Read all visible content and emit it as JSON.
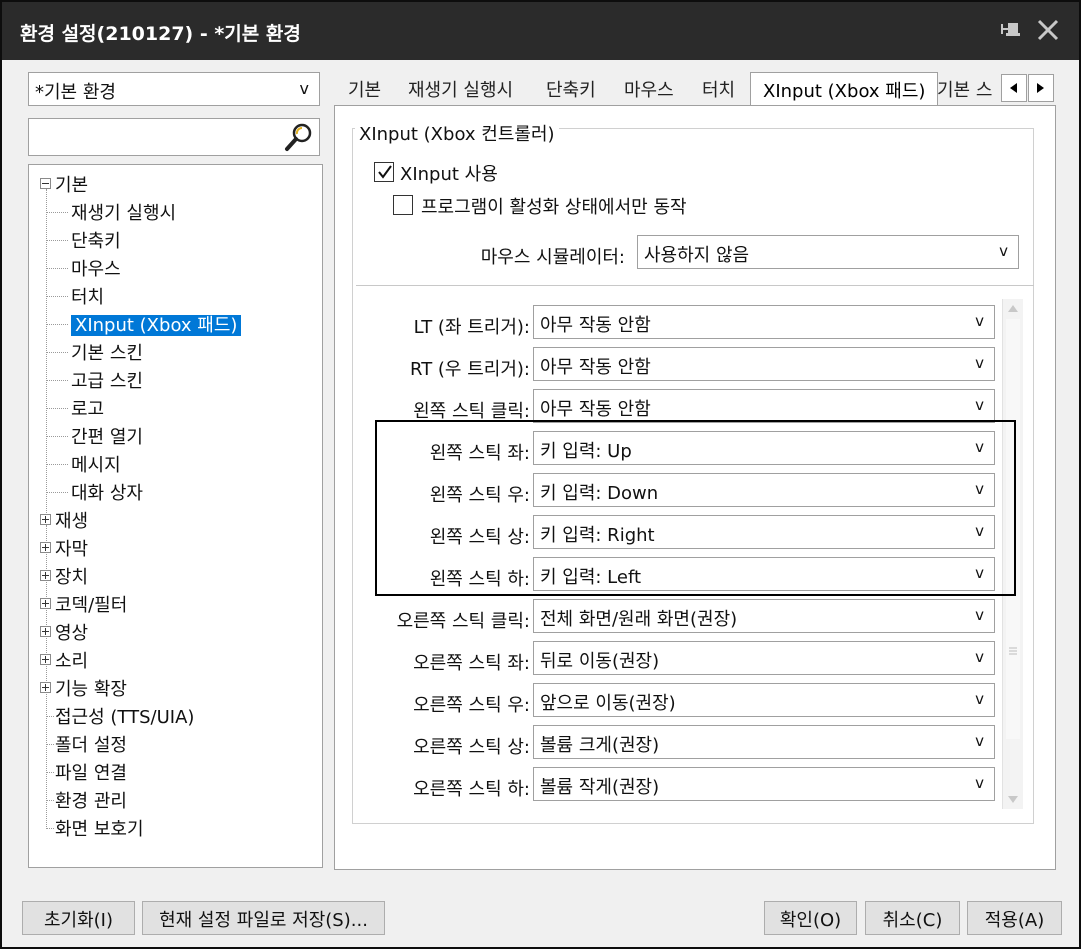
{
  "window": {
    "title": "환경 설정(210127) - *기본 환경"
  },
  "left": {
    "profile": "*기본 환경",
    "search_placeholder": "",
    "tree": [
      {
        "label": "기본",
        "expander": "minus"
      },
      {
        "label": "재생기 실행시"
      },
      {
        "label": "단축키"
      },
      {
        "label": "마우스"
      },
      {
        "label": "터치"
      },
      {
        "label": "XInput (Xbox 패드)",
        "selected": true
      },
      {
        "label": "기본 스킨"
      },
      {
        "label": "고급 스킨"
      },
      {
        "label": "로고"
      },
      {
        "label": "간편 열기"
      },
      {
        "label": "메시지"
      },
      {
        "label": "대화 상자"
      },
      {
        "label": "재생",
        "expander": "plus"
      },
      {
        "label": "자막",
        "expander": "plus"
      },
      {
        "label": "장치",
        "expander": "plus"
      },
      {
        "label": "코덱/필터",
        "expander": "plus"
      },
      {
        "label": "영상",
        "expander": "plus"
      },
      {
        "label": "소리",
        "expander": "plus"
      },
      {
        "label": "기능 확장",
        "expander": "plus"
      },
      {
        "label": "접근성 (TTS/UIA)"
      },
      {
        "label": "폴더 설정"
      },
      {
        "label": "파일 연결"
      },
      {
        "label": "환경 관리"
      },
      {
        "label": "화면 보호기"
      }
    ]
  },
  "tabs": [
    "기본",
    "재생기 실행시",
    "단축키",
    "마우스",
    "터치",
    "XInput (Xbox 패드)",
    "기본 스"
  ],
  "panel": {
    "group_title": "XInput (Xbox 컨트롤러)",
    "enable_label": "XInput 사용",
    "enable_checked": true,
    "active_only_label": "프로그램이 활성화 상태에서만 동작",
    "active_only_checked": false,
    "mouse_sim_label": "마우스 시뮬레이터:",
    "mouse_sim_value": "사용하지 않음",
    "mappings": [
      {
        "label": "LT (좌 트리거):",
        "value": "아무 작동 안함"
      },
      {
        "label": "RT (우 트리거):",
        "value": "아무 작동 안함"
      },
      {
        "label": "왼쪽 스틱 클릭:",
        "value": "아무 작동 안함"
      },
      {
        "label": "왼쪽 스틱 좌:",
        "value": "키 입력: Up"
      },
      {
        "label": "왼쪽 스틱 우:",
        "value": "키 입력: Down"
      },
      {
        "label": "왼쪽 스틱 상:",
        "value": "키 입력: Right"
      },
      {
        "label": "왼쪽 스틱 하:",
        "value": "키 입력: Left"
      },
      {
        "label": "오른쪽 스틱 클릭:",
        "value": "전체 화면/원래 화면(권장)"
      },
      {
        "label": "오른쪽 스틱 좌:",
        "value": "뒤로 이동(권장)"
      },
      {
        "label": "오른쪽 스틱 우:",
        "value": "앞으로 이동(권장)"
      },
      {
        "label": "오른쪽 스틱 상:",
        "value": "볼륨 크게(권장)"
      },
      {
        "label": "오른쪽 스틱 하:",
        "value": "볼륨 작게(권장)"
      }
    ]
  },
  "buttons": {
    "reset": "초기화(I)",
    "save_file": "현재 설정 파일로 저장(S)...",
    "ok": "확인(O)",
    "cancel": "취소(C)",
    "apply": "적용(A)"
  },
  "chevron": "v"
}
